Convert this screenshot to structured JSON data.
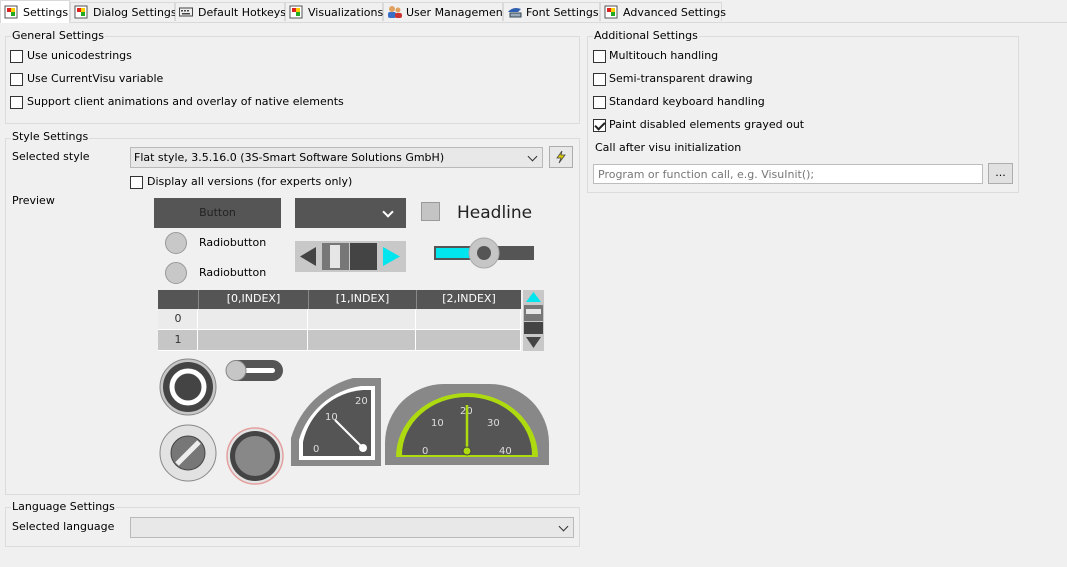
{
  "tabs": [
    {
      "label": "Settings",
      "icon": "settings-tab-icon",
      "active": true
    },
    {
      "label": "Dialog Settings",
      "icon": "dialog-settings-icon"
    },
    {
      "label": "Default Hotkeys",
      "icon": "keyboard-icon"
    },
    {
      "label": "Visualizations",
      "icon": "visualizations-icon"
    },
    {
      "label": "User Management",
      "icon": "users-icon"
    },
    {
      "label": "Font Settings",
      "icon": "font-icon"
    },
    {
      "label": "Advanced Settings",
      "icon": "advanced-settings-icon"
    }
  ],
  "general": {
    "title": "General Settings",
    "opt1": "Use unicodestrings",
    "opt2": "Use CurrentVisu variable",
    "opt3": "Support client animations and overlay of native elements"
  },
  "style": {
    "title": "Style Settings",
    "selected_label": "Selected style",
    "selected_value": "Flat style, 3.5.16.0 (3S-Smart Software Solutions GmbH)",
    "display_all": "Display all versions (for experts only)",
    "preview_label": "Preview"
  },
  "preview": {
    "button": "Button",
    "radio1": "Radiobutton",
    "radio2": "Radiobutton",
    "headline": "Headline",
    "table_headers": [
      "[0,INDEX]",
      "[1,INDEX]",
      "[2,INDEX]"
    ],
    "rows": [
      "0",
      "1"
    ],
    "gauge1_ticks": [
      "0",
      "10",
      "20"
    ],
    "gauge2_ticks": [
      "0",
      "10",
      "20",
      "30",
      "40"
    ],
    "accent": "#00e5ee",
    "dark": "#555555"
  },
  "language": {
    "title": "Language Settings",
    "selected_label": "Selected language",
    "selected_value": ""
  },
  "additional": {
    "title": "Additional Settings",
    "opt1": "Multitouch handling",
    "opt2": "Semi-transparent drawing",
    "opt3": "Standard keyboard handling",
    "opt4": "Paint disabled elements grayed out",
    "call_label": "Call after visu initialization",
    "call_placeholder": "Program or function call, e.g. VisuInit();",
    "browse_label": "..."
  }
}
